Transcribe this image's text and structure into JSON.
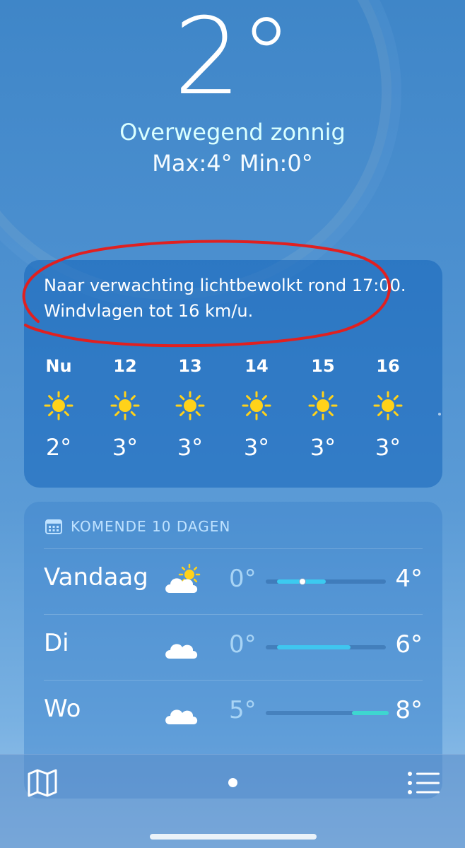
{
  "current": {
    "temperature": "2°",
    "condition": "Overwegend zonnig",
    "max_min": "Max:4°  Min:0°"
  },
  "hourly": {
    "summary": "Naar verwachting lichtbewolkt rond 17:00. Windvlagen tot 16 km/u.",
    "items": [
      {
        "label": "Nu",
        "icon": "sun-icon",
        "temp": "2°"
      },
      {
        "label": "12",
        "icon": "sun-icon",
        "temp": "3°"
      },
      {
        "label": "13",
        "icon": "sun-icon",
        "temp": "3°"
      },
      {
        "label": "14",
        "icon": "sun-icon",
        "temp": "3°"
      },
      {
        "label": "15",
        "icon": "sun-icon",
        "temp": "3°"
      },
      {
        "label": "16",
        "icon": "sun-icon",
        "temp": "3°"
      }
    ]
  },
  "daily": {
    "header": "KOMENDE 10 DAGEN",
    "range": {
      "min": 0,
      "max": 8
    },
    "rows": [
      {
        "day": "Vandaag",
        "icon": "partly-sunny-icon",
        "low": "0°",
        "high": "4°",
        "low_val": 0,
        "high_val": 4,
        "current_val": 2,
        "color": "#3ccaf0"
      },
      {
        "day": "Di",
        "icon": "cloud-icon",
        "low": "0°",
        "high": "6°",
        "low_val": 0,
        "high_val": 6,
        "color": "#3fc6ef"
      },
      {
        "day": "Wo",
        "icon": "cloud-icon",
        "low": "5°",
        "high": "8°",
        "low_val": 5,
        "high_val": 8,
        "color": "#3ed6d0"
      }
    ]
  },
  "tabbar": {
    "map_icon": "map-icon",
    "list_icon": "list-icon"
  },
  "colors": {
    "annotation": "#e02020",
    "sun": "#ffd21a",
    "condition_text": "#d9ffff"
  }
}
